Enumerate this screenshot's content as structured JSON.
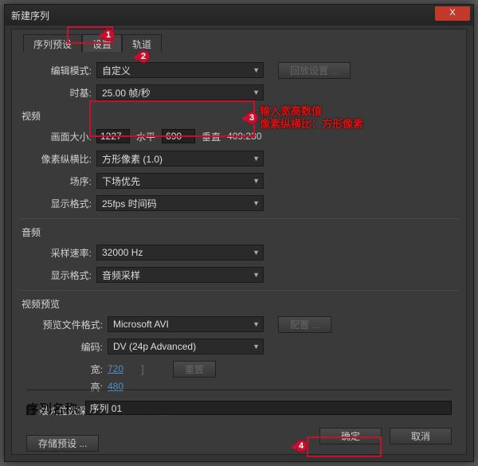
{
  "window": {
    "title": "新建序列",
    "close": "X"
  },
  "tabs": {
    "t0": "序列预设",
    "t1": "设置",
    "t2": "轨道"
  },
  "edit_mode": {
    "label": "编辑模式:",
    "value": "自定义",
    "btn": "回放设置 ..."
  },
  "timebase": {
    "label": "时基:",
    "value": "25.00 帧/秒"
  },
  "video": {
    "title": "视频",
    "frame_label": "画面大小:",
    "w": "1227",
    "h": "690",
    "hlabel": "水平",
    "vlabel": "垂直",
    "ratio": "409:230",
    "par_label": "像素纵横比:",
    "par_value": "方形像素 (1.0)",
    "fields_label": "场序:",
    "fields_value": "下场优先",
    "disp_label": "显示格式:",
    "disp_value": "25fps 时间码"
  },
  "audio": {
    "title": "音频",
    "rate_label": "采样速率:",
    "rate_value": "32000 Hz",
    "disp_label": "显示格式:",
    "disp_value": "音频采样"
  },
  "preview": {
    "title": "视频预览",
    "file_label": "预览文件格式:",
    "file_value": "Microsoft AVI",
    "cfg": "配置 ...",
    "codec_label": "编码:",
    "codec_value": "DV (24p Advanced)",
    "w_label": "宽:",
    "w_value": "720",
    "h_label": "高:",
    "h_value": "480",
    "reset": "重置",
    "max_bit": "最大位数深度",
    "max_q": "最高渲染品质"
  },
  "save_preset": "存储预设 ...",
  "seq": {
    "label": "序列名称:",
    "value": "序列 01"
  },
  "footer": {
    "ok": "确定",
    "cancel": "取消"
  },
  "annotations": {
    "m1": "1",
    "m2": "2",
    "m3": "3",
    "m4": "4",
    "line1": "输入宽高数值",
    "line2": "像素纵横比：方形像素"
  }
}
